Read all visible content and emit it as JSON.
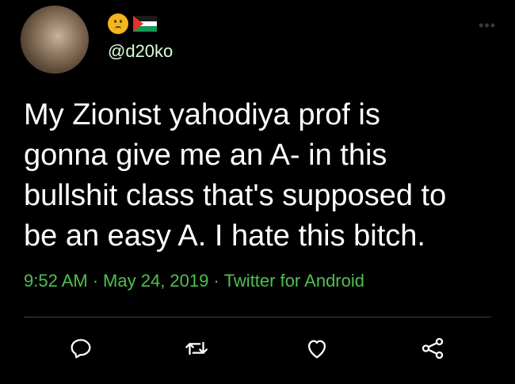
{
  "user": {
    "handle": "@d20ko",
    "name_emojis": [
      "frowning-face-icon",
      "palestine-flag-icon"
    ]
  },
  "more_icon": "more-icon",
  "tweet": {
    "text": "My Zionist yahodiya prof is\ngonna give me an A- in this\nbullshit class that's supposed to\nbe an easy A. I hate this bitch.",
    "time": "9:52 AM",
    "date": "May 24, 2019",
    "source": "Twitter for Android",
    "separator": "·"
  },
  "actions": [
    "reply-icon",
    "retweet-icon",
    "like-icon",
    "share-icon"
  ],
  "colors": {
    "background": "#000000",
    "text": "#ffffff",
    "meta": "#4fc14f",
    "divider": "#3d4144"
  }
}
